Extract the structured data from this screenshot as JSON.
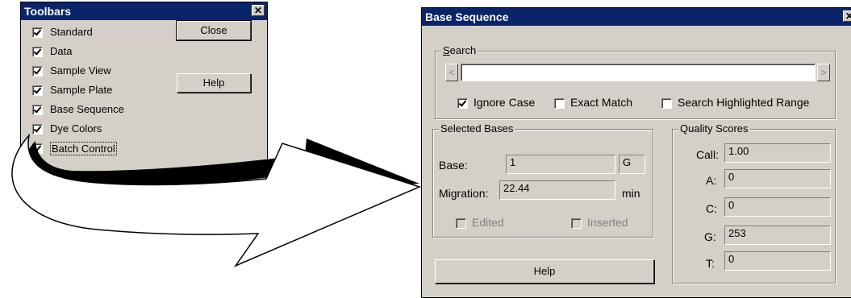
{
  "toolbars_dialog": {
    "title": "Toolbars",
    "items": [
      {
        "label": "Standard",
        "checked": true
      },
      {
        "label": "Data",
        "checked": true
      },
      {
        "label": "Sample View",
        "checked": true
      },
      {
        "label": "Sample Plate",
        "checked": true
      },
      {
        "label": "Base Sequence",
        "checked": true
      },
      {
        "label": "Dye Colors",
        "checked": true
      },
      {
        "label": "Batch Control",
        "checked": true
      }
    ],
    "close_label": "Close",
    "help_label": "Help"
  },
  "base_sequence_dialog": {
    "title": "Base Sequence",
    "search": {
      "group_title": "Search",
      "value": "",
      "ignore_case_label": "Ignore Case",
      "ignore_case_checked": true,
      "exact_match_label": "Exact Match",
      "exact_match_checked": false,
      "highlighted_label": "Search Highlighted Range",
      "highlighted_checked": false
    },
    "selected_bases": {
      "group_title": "Selected Bases",
      "base_label": "Base:",
      "base_value": "1",
      "base_letter": "G",
      "migration_label": "Migration:",
      "migration_value": "22.44",
      "migration_unit": "min",
      "edited_label": "Edited",
      "inserted_label": "Inserted"
    },
    "quality_scores": {
      "group_title": "Quality Scores",
      "rows": [
        {
          "label": "Call:",
          "value": "1.00"
        },
        {
          "label": "A:",
          "value": "0"
        },
        {
          "label": "C:",
          "value": "0"
        },
        {
          "label": "G:",
          "value": "253"
        },
        {
          "label": "T:",
          "value": "0"
        }
      ]
    },
    "help_label": "Help"
  }
}
